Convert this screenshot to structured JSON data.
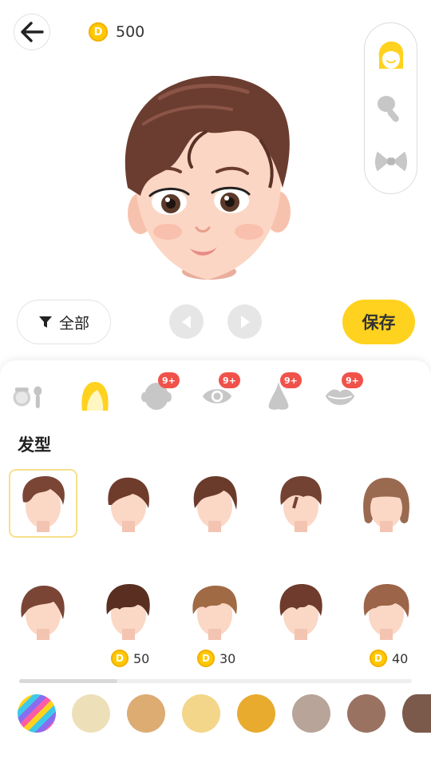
{
  "coins": {
    "balance": "500",
    "symbol": "D"
  },
  "filter": {
    "label": "全部"
  },
  "save": {
    "label": "保存"
  },
  "side_panel": {
    "items": [
      {
        "icon": "hair-face-icon",
        "active": true
      },
      {
        "icon": "brush-icon",
        "active": false
      },
      {
        "icon": "bow-icon",
        "active": false
      }
    ]
  },
  "categories": [
    {
      "icon": "makeup-icon",
      "badge": ""
    },
    {
      "icon": "hair-icon",
      "badge": "",
      "active": true
    },
    {
      "icon": "head-shape-icon",
      "badge": "9+"
    },
    {
      "icon": "eye-icon",
      "badge": "9+"
    },
    {
      "icon": "nose-icon",
      "badge": "9+"
    },
    {
      "icon": "lips-icon",
      "badge": "9+"
    }
  ],
  "section": {
    "title": "发型"
  },
  "hairstyles": [
    {
      "price": "",
      "selected": true
    },
    {
      "price": ""
    },
    {
      "price": ""
    },
    {
      "price": ""
    },
    {
      "price": ""
    },
    {
      "price": ""
    },
    {
      "price": "50"
    },
    {
      "price": "30"
    },
    {
      "price": ""
    },
    {
      "price": "40"
    }
  ],
  "colors": {
    "accent": "#ffd21f",
    "badge": "#f0524a",
    "hair_swatches": [
      "rainbow",
      "#ede0b9",
      "#dcac72",
      "#f3d68a",
      "#e8ab2e",
      "#b8a498",
      "#9a7262",
      "#7b5a4c"
    ]
  }
}
